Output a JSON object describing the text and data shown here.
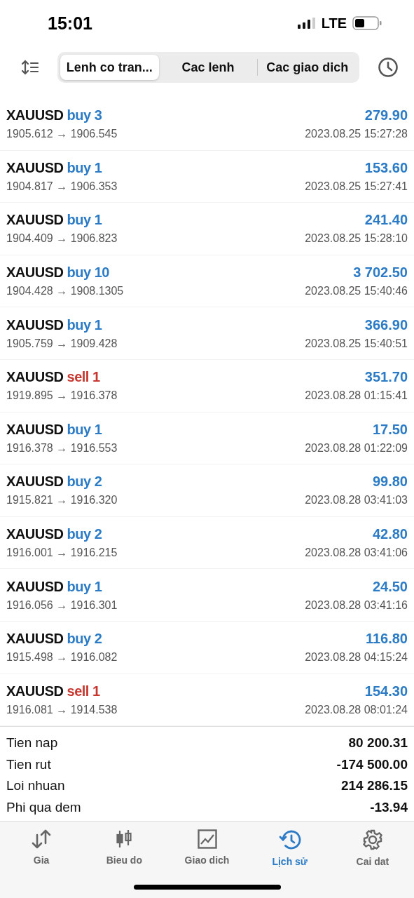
{
  "status_bar": {
    "time": "15:01",
    "network": "LTE"
  },
  "segments": [
    {
      "label": "Lenh co tran...",
      "selected": true
    },
    {
      "label": "Cac lenh",
      "selected": false
    },
    {
      "label": "Cac giao dich",
      "selected": false
    }
  ],
  "deals": [
    {
      "symbol": "XAUUSD",
      "side": "buy",
      "kind": "buy",
      "volume": "3",
      "prices": "1905.612 → 1906.545",
      "profit": "279.90",
      "time": "2023.08.25 15:27:28"
    },
    {
      "symbol": "XAUUSD",
      "side": "buy",
      "kind": "buy",
      "volume": "1",
      "prices": "1904.817 → 1906.353",
      "profit": "153.60",
      "time": "2023.08.25 15:27:41"
    },
    {
      "symbol": "XAUUSD",
      "side": "buy",
      "kind": "buy",
      "volume": "1",
      "prices": "1904.409 → 1906.823",
      "profit": "241.40",
      "time": "2023.08.25 15:28:10"
    },
    {
      "symbol": "XAUUSD",
      "side": "buy",
      "kind": "buy",
      "volume": "10",
      "prices": "1904.428 → 1908.1305",
      "profit": "3 702.50",
      "time": "2023.08.25 15:40:46"
    },
    {
      "symbol": "XAUUSD",
      "side": "buy",
      "kind": "buy",
      "volume": "1",
      "prices": "1905.759 → 1909.428",
      "profit": "366.90",
      "time": "2023.08.25 15:40:51"
    },
    {
      "symbol": "XAUUSD",
      "side": "sell",
      "kind": "sell",
      "volume": "1",
      "prices": "1919.895 → 1916.378",
      "profit": "351.70",
      "time": "2023.08.28 01:15:41"
    },
    {
      "symbol": "XAUUSD",
      "side": "buy",
      "kind": "buy",
      "volume": "1",
      "prices": "1916.378 → 1916.553",
      "profit": "17.50",
      "time": "2023.08.28 01:22:09"
    },
    {
      "symbol": "XAUUSD",
      "side": "buy",
      "kind": "buy",
      "volume": "2",
      "prices": "1915.821 → 1916.320",
      "profit": "99.80",
      "time": "2023.08.28 03:41:03"
    },
    {
      "symbol": "XAUUSD",
      "side": "buy",
      "kind": "buy",
      "volume": "2",
      "prices": "1916.001 → 1916.215",
      "profit": "42.80",
      "time": "2023.08.28 03:41:06"
    },
    {
      "symbol": "XAUUSD",
      "side": "buy",
      "kind": "buy",
      "volume": "1",
      "prices": "1916.056 → 1916.301",
      "profit": "24.50",
      "time": "2023.08.28 03:41:16"
    },
    {
      "symbol": "XAUUSD",
      "side": "buy",
      "kind": "buy",
      "volume": "2",
      "prices": "1915.498 → 1916.082",
      "profit": "116.80",
      "time": "2023.08.28 04:15:24"
    },
    {
      "symbol": "XAUUSD",
      "side": "sell",
      "kind": "sell",
      "volume": "1",
      "prices": "1916.081 → 1914.538",
      "profit": "154.30",
      "time": "2023.08.28 08:01:24"
    }
  ],
  "summary": [
    {
      "label": "Tien nap",
      "value": "80 200.31"
    },
    {
      "label": "Tien rut",
      "value": "-174 500.00"
    },
    {
      "label": "Loi nhuan",
      "value": "214 286.15"
    },
    {
      "label": "Phi qua dem",
      "value": "-13.94"
    }
  ],
  "tab_bar": [
    {
      "label": "Gia",
      "kind": "quotes",
      "selected": false
    },
    {
      "label": "Bieu do",
      "kind": "chart",
      "selected": false
    },
    {
      "label": "Giao dich",
      "kind": "trade",
      "selected": false
    },
    {
      "label": "Lịch sử",
      "kind": "history",
      "selected": true
    },
    {
      "label": "Cai dat",
      "kind": "settings",
      "selected": false
    }
  ]
}
